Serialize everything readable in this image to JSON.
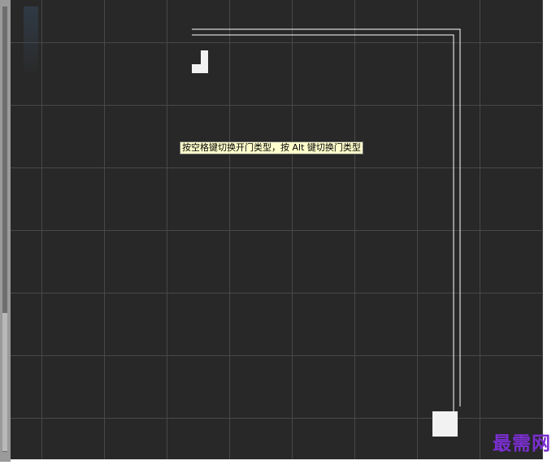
{
  "canvas": {
    "tooltip_text": "按空格键切换开门类型，按 Alt 键切换门类型"
  },
  "watermark": {
    "text": "最需网"
  },
  "colors": {
    "background": "#282828",
    "grid": "#484848",
    "wall": "#ffffff",
    "tooltip_bg": "#ffffcc",
    "watermark": "#7a2fd0"
  },
  "icons": {
    "door_grip": "l-shaped-grip-icon",
    "corner_grip": "square-grip-icon"
  }
}
